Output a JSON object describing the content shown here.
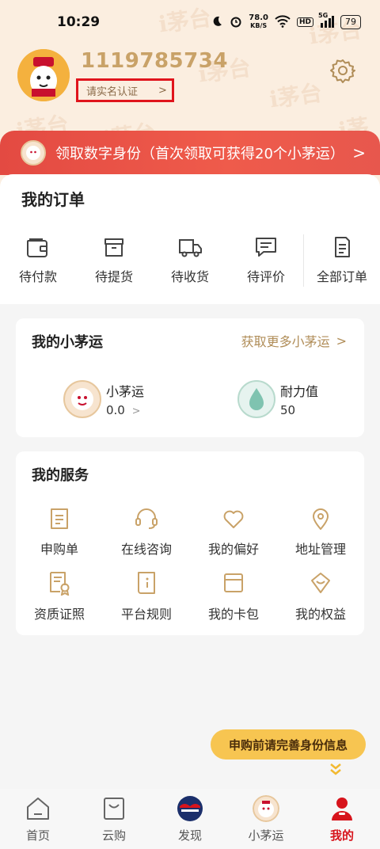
{
  "status_bar": {
    "time": "10:29",
    "net_speed_value": "78.0",
    "net_speed_unit": "KB/S",
    "hd_label": "HD",
    "signal_label": "5G",
    "battery": "79"
  },
  "header": {
    "user_id": "1119785734",
    "verify_label": "请实名认证",
    "verify_chevron": ">",
    "watermark_text": "i茅台"
  },
  "banner": {
    "text": "领取数字身份（首次领取可获得20个小茅运）",
    "chevron": ">"
  },
  "orders": {
    "title": "我的订单",
    "items": [
      {
        "label": "待付款",
        "icon": "wallet-icon"
      },
      {
        "label": "待提货",
        "icon": "box-icon"
      },
      {
        "label": "待收货",
        "icon": "truck-icon"
      },
      {
        "label": "待评价",
        "icon": "comment-icon"
      },
      {
        "label": "全部订单",
        "icon": "document-icon"
      }
    ]
  },
  "luck": {
    "title": "我的小茅运",
    "more_link": "获取更多小茅运",
    "more_chevron": ">",
    "items": [
      {
        "label": "小茅运",
        "value": "0.0",
        "chevron": ">"
      },
      {
        "label": "耐力值",
        "value": "50"
      }
    ]
  },
  "services": {
    "title": "我的服务",
    "items": [
      {
        "label": "申购单",
        "icon": "note-icon"
      },
      {
        "label": "在线咨询",
        "icon": "headset-icon"
      },
      {
        "label": "我的偏好",
        "icon": "heart-icon"
      },
      {
        "label": "地址管理",
        "icon": "location-icon"
      },
      {
        "label": "资质证照",
        "icon": "certificate-icon"
      },
      {
        "label": "平台规则",
        "icon": "rulebook-icon"
      },
      {
        "label": "我的卡包",
        "icon": "card-icon"
      },
      {
        "label": "我的权益",
        "icon": "benefit-icon"
      }
    ]
  },
  "float_tip": {
    "label": "申购前请完善身份信息"
  },
  "tabbar": {
    "items": [
      {
        "label": "首页",
        "icon": "home-icon"
      },
      {
        "label": "云购",
        "icon": "bag-icon"
      },
      {
        "label": "发现",
        "icon": "discover-icon"
      },
      {
        "label": "小茅运",
        "icon": "luck-icon"
      },
      {
        "label": "我的",
        "icon": "profile-icon",
        "active": true
      }
    ]
  },
  "colors": {
    "accent_gold": "#b08d58",
    "banner_red": "#e34a42",
    "active_red": "#d7141c",
    "pill_yellow": "#f7c551"
  }
}
